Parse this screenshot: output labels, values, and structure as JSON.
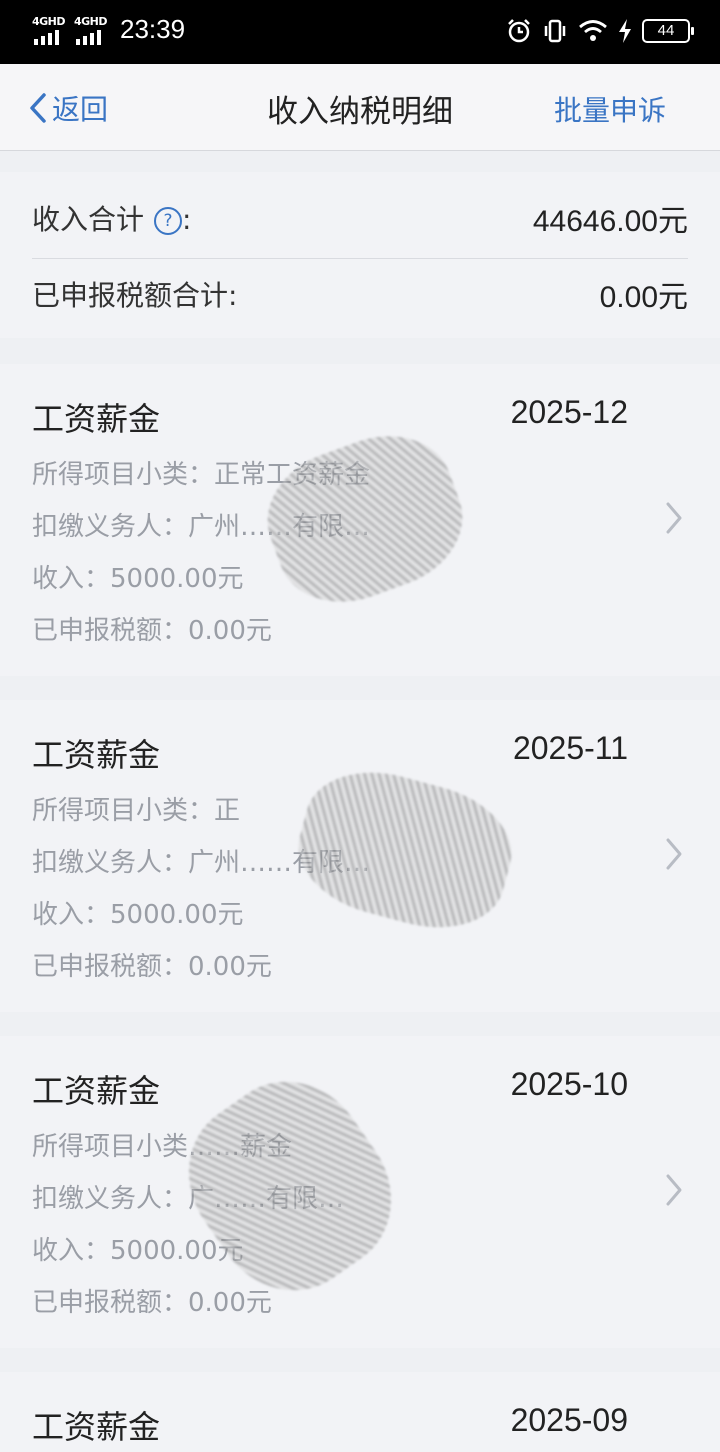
{
  "status_bar": {
    "network_1": "4GHD",
    "network_2": "4GHD",
    "time": "23:39",
    "battery": "44"
  },
  "nav": {
    "back_label": "返回",
    "title": "收入纳税明细",
    "action_label": "批量申诉"
  },
  "summary": {
    "income_label": "收入合计",
    "income_colon": ":",
    "income_value": "44646.00元",
    "tax_label": "已申报税额合计:",
    "tax_value": "0.00元"
  },
  "records": [
    {
      "title": "工资薪金",
      "period": "2025-12",
      "subcategory": "所得项目小类：正常工资薪金",
      "withholder": "扣缴义务人：广州……有限…",
      "income": "收入：5000.00元",
      "tax": "已申报税额：0.00元"
    },
    {
      "title": "工资薪金",
      "period": "2025-11",
      "subcategory": "所得项目小类：正",
      "withholder": "扣缴义务人：广州……有限…",
      "income": "收入：5000.00元",
      "tax": "已申报税额：0.00元"
    },
    {
      "title": "工资薪金",
      "period": "2025-10",
      "subcategory": "所得项目小类……薪金",
      "withholder": "扣缴义务人：广……有限…",
      "income": "收入：5000.00元",
      "tax": "已申报税额：0.00元"
    },
    {
      "title": "工资薪金",
      "period": "2025-09"
    }
  ],
  "colors": {
    "accent": "#3a75c4",
    "background": "#eef0f3",
    "card": "#f2f3f6",
    "muted_text": "#9a9ea6"
  },
  "icons": {
    "back": "chevron-left-icon",
    "help": "question-circle-icon",
    "row_arrow": "chevron-right-icon",
    "alarm": "alarm-icon",
    "vibrate": "vibrate-icon",
    "wifi": "wifi-icon",
    "charging": "bolt-icon"
  }
}
